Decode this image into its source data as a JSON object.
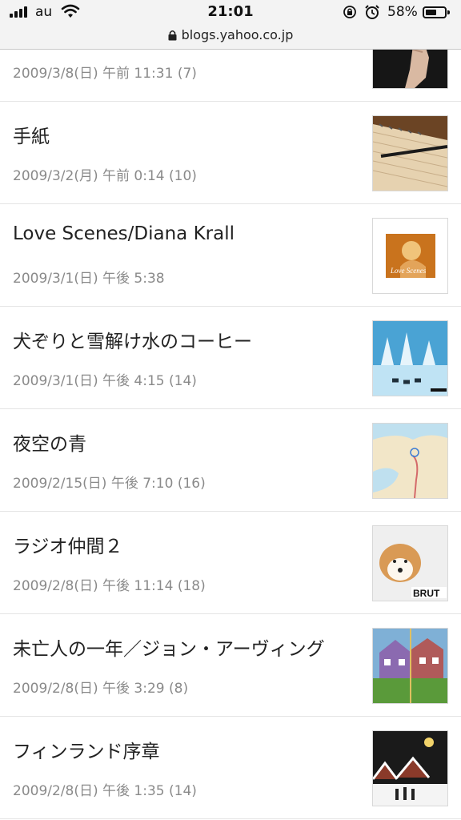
{
  "status_bar": {
    "carrier": "au",
    "time": "21:01",
    "battery_percent": "58%",
    "battery_level": 0.58
  },
  "url_bar": {
    "url": "blogs.yahoo.co.jp"
  },
  "articles": [
    {
      "title": "",
      "meta": "2009/3/8(日) 午前 11:31 (7)",
      "thumb": "hand-photo"
    },
    {
      "title": "手紙",
      "meta": "2009/3/2(月) 午前 0:14 (10)",
      "thumb": "notebook-pen-photo"
    },
    {
      "title": "Love Scenes/Diana Krall",
      "meta": "2009/3/1(日) 午後 5:38",
      "thumb": "album-cover-love-scenes"
    },
    {
      "title": "犬ぞりと雪解け水のコーヒー",
      "meta": "2009/3/1(日) 午後 4:15 (14)",
      "thumb": "dog-sled-snow-photo"
    },
    {
      "title": "夜空の青",
      "meta": "2009/2/15(日) 午後 7:10 (16)",
      "thumb": "map-image"
    },
    {
      "title": "ラジオ仲間２",
      "meta": "2009/2/8(日) 午後 11:14 (18)",
      "thumb": "akita-dog-magazine-cover"
    },
    {
      "title": "未亡人の一年／ジョン・アーヴィング",
      "meta": "2009/2/8(日) 午後 3:29 (8)",
      "thumb": "book-cover-houses"
    },
    {
      "title": "フィンランド序章",
      "meta": "2009/2/8(日) 午後 1:35 (14)",
      "thumb": "snowy-village-painting"
    }
  ]
}
